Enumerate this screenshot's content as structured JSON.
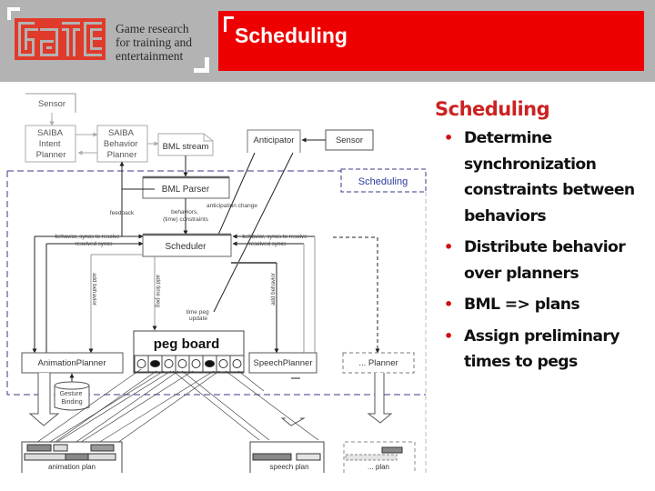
{
  "header": {
    "logo": {
      "name": "GATE",
      "tagline_lines": [
        "Game research",
        "for training and",
        "entertainment"
      ],
      "color": "#e03a2a"
    },
    "banner": {
      "title": "Scheduling",
      "color": "#ee0000"
    }
  },
  "diagram": {
    "nodes": {
      "sensor_top": "Sensor",
      "intent_planner": [
        "SAIBA",
        "Intent",
        "Planner"
      ],
      "behavior_planner": [
        "SAIBA",
        "Behavior",
        "Planner"
      ],
      "bml_stream": "BML stream",
      "anticipator": "Anticipator",
      "sensor_right": "Sensor",
      "scheduling_label": "Scheduling",
      "bml_parser": "BML Parser",
      "scheduler": "Scheduler",
      "peg_board": "peg board",
      "animation_planner": "AnimationPlanner",
      "speech_planner": "SpeechPlanner",
      "other_planner": "... Planner",
      "gesture_binding": [
        "Gesture",
        "Binding"
      ],
      "animation_plan": "animation plan",
      "speech_plan": "speech plan",
      "other_plan": "... plan"
    },
    "edge_labels": {
      "feedback": "feedback",
      "behaviors_constraints": [
        "behaviors,",
        "(time) constraints"
      ],
      "anticipation_change": "anticipation change",
      "behavior_syncs_left": "behavior, syncs to resolve",
      "resolved_syncs_left": "resolved syncs",
      "behavior_syncs_right": "behavior, syncs to resolve",
      "resolved_syncs_right": "resolved syncs",
      "add_behavior_left": "add behavior",
      "add_time_peg": "add time peg",
      "time_peg_update": [
        "time peg",
        "update"
      ],
      "add_behavior_right": "add behavior"
    },
    "peg_slots": [
      "empty",
      "filled",
      "empty",
      "empty",
      "empty",
      "filled",
      "empty",
      "empty"
    ],
    "colors": {
      "scheduling_border": "#3a3a8a",
      "scheduling_text": "#2a3aa0",
      "line": "#222222",
      "gray_line": "#9a9a9a"
    }
  },
  "side": {
    "title": "Scheduling",
    "title_color": "#cc2222",
    "bullets": [
      "Determine synchronization constraints between behaviors",
      "Distribute behavior over planners",
      "BML => plans",
      "Assign preliminary times to pegs"
    ]
  }
}
